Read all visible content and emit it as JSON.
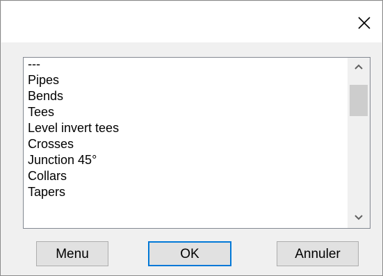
{
  "window": {
    "title": "",
    "close_icon": "close-icon"
  },
  "list": {
    "items": [
      "---",
      "Pipes",
      "Bends",
      "Tees",
      "Level invert tees",
      "Crosses",
      "Junction 45°",
      "Collars",
      "Tapers"
    ]
  },
  "buttons": {
    "menu": "Menu",
    "ok": "OK",
    "cancel": "Annuler"
  },
  "colors": {
    "accent": "#0078d7",
    "window_bg": "#f0f0f0",
    "scroll_thumb": "#cdcdcd"
  }
}
